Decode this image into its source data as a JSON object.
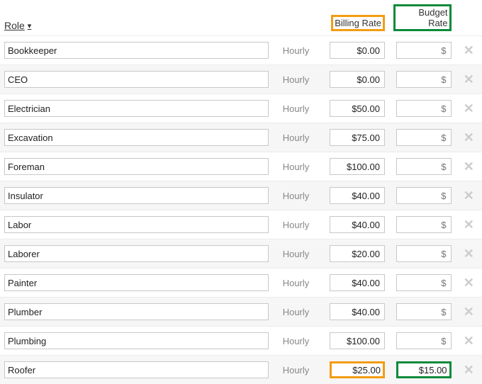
{
  "headers": {
    "role": "Role",
    "billing_rate": "Billing Rate",
    "budget_rate": "Budget Rate"
  },
  "rate_type_label": "Hourly",
  "budget_placeholder": "$",
  "rows": [
    {
      "role": "Bookkeeper",
      "billing": "$0.00",
      "budget": "",
      "hi_bill": false,
      "hi_budget": false
    },
    {
      "role": "CEO",
      "billing": "$0.00",
      "budget": "",
      "hi_bill": false,
      "hi_budget": false
    },
    {
      "role": "Electrician",
      "billing": "$50.00",
      "budget": "",
      "hi_bill": false,
      "hi_budget": false
    },
    {
      "role": "Excavation",
      "billing": "$75.00",
      "budget": "",
      "hi_bill": false,
      "hi_budget": false
    },
    {
      "role": "Foreman",
      "billing": "$100.00",
      "budget": "",
      "hi_bill": false,
      "hi_budget": false
    },
    {
      "role": "Insulator",
      "billing": "$40.00",
      "budget": "",
      "hi_bill": false,
      "hi_budget": false
    },
    {
      "role": "Labor",
      "billing": "$40.00",
      "budget": "",
      "hi_bill": false,
      "hi_budget": false
    },
    {
      "role": "Laborer",
      "billing": "$20.00",
      "budget": "",
      "hi_bill": false,
      "hi_budget": false
    },
    {
      "role": "Painter",
      "billing": "$40.00",
      "budget": "",
      "hi_bill": false,
      "hi_budget": false
    },
    {
      "role": "Plumber",
      "billing": "$40.00",
      "budget": "",
      "hi_bill": false,
      "hi_budget": false
    },
    {
      "role": "Plumbing",
      "billing": "$100.00",
      "budget": "",
      "hi_bill": false,
      "hi_budget": false
    },
    {
      "role": "Roofer",
      "billing": "$25.00",
      "budget": "$15.00",
      "hi_bill": true,
      "hi_budget": true
    }
  ]
}
